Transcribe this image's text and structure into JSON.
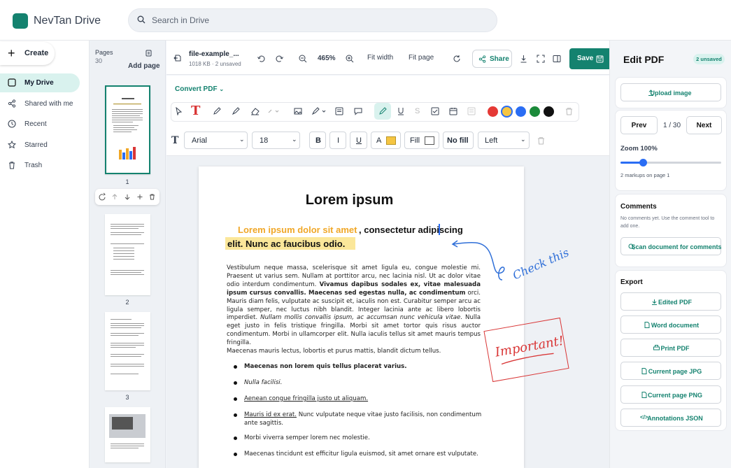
{
  "app": {
    "name": "NevTan Drive"
  },
  "search": {
    "placeholder": "Search in Drive"
  },
  "nav": {
    "create": "Create",
    "items": [
      "My Drive",
      "Shared with me",
      "Recent",
      "Starred",
      "Trash"
    ],
    "active": "My Drive"
  },
  "pages": {
    "label": "Pages",
    "count": "30",
    "add": "Add page",
    "numbers": [
      "1",
      "2",
      "3"
    ]
  },
  "file": {
    "name": "file-example_...",
    "meta": "1018 KB  ·  2 unsaved"
  },
  "header": {
    "zoom": "465%",
    "fit_width": "Fit width",
    "fit_page": "Fit page",
    "share": "Share",
    "save": "Save"
  },
  "toolbar": {
    "convert": "Convert PDF",
    "font": "Arial",
    "size": "18",
    "bold": "B",
    "italic": "I",
    "underline": "U",
    "color_label": "A",
    "fill": "Fill",
    "no_fill": "No fill",
    "align": "Left",
    "text_tool": "T",
    "colors": [
      "#e53935",
      "#f5c542",
      "#2a6df4",
      "#1b8a3a",
      "#111111"
    ],
    "selected_color": "#f5c542"
  },
  "document": {
    "title": "Lorem ipsum",
    "highlight_a": "Lorem ipsum dolor sit amet",
    "highlight_b": ", consectetur adipiscing",
    "highlight_c": "elit. Nunc ac faucibus odio.",
    "para1_a": "Vestibulum neque massa, scelerisque sit amet ligula eu, congue molestie mi. Praesent ut varius sem. Nullam at porttitor arcu, nec lacinia nisl. Ut ac dolor vitae odio interdum condimentum. ",
    "para1_b": "Vivamus dapibus sodales ex, vitae malesuada ipsum cursus convallis. Maecenas sed egestas nulla, ac condimentum",
    "para1_c": " orci. Mauris diam felis, vulputate ac suscipit et, iaculis non est. Curabitur semper arcu ac ligula semper, nec luctus nibh blandit. Integer lacinia ante ac libero lobortis imperdiet. ",
    "para1_d": "Nullam mollis convallis ipsum, ac accumsan nunc vehicula vitae.",
    "para1_e": " Nulla eget justo in felis tristique fringilla. Morbi sit amet tortor quis risus auctor condimentum. Morbi in ullamcorper elit. Nulla iaculis tellus sit amet mauris tempus fringilla.",
    "para2": "Maecenas mauris lectus, lobortis et purus mattis, blandit dictum tellus.",
    "bullet1": "Maecenas non lorem quis tellus placerat varius.",
    "bullet2": "Nulla facilisi.",
    "bullet3": "Aenean congue fringilla justo ut aliquam.",
    "bullet4_a": "Mauris id ex erat.",
    "bullet4_b": " Nunc vulputate neque vitae justo facilisis, non condimentum ante sagittis.",
    "bullet5": "Morbi viverra semper lorem nec molestie.",
    "bullet6": "Maecenas tincidunt est efficitur ligula euismod, sit amet ornare est vulputate.",
    "annot_check": "Check this",
    "annot_important": "Important!"
  },
  "panel": {
    "title": "Edit PDF",
    "unsaved": "2 unsaved",
    "upload": "Upload image",
    "prev": "Prev",
    "next": "Next",
    "page_counter": "1 / 30",
    "zoom_label": "Zoom 100%",
    "zoom_level_fraction": 0.22,
    "markups": "2 markups on page 1",
    "comments_title": "Comments",
    "comments_text": "No comments yet. Use the comment tool to add one.",
    "scan": "Scan document for comments",
    "export_title": "Export",
    "exports": [
      "Edited PDF",
      "Word document",
      "Print PDF",
      "Current page JPG",
      "Current page PNG",
      "Annotations JSON"
    ]
  }
}
